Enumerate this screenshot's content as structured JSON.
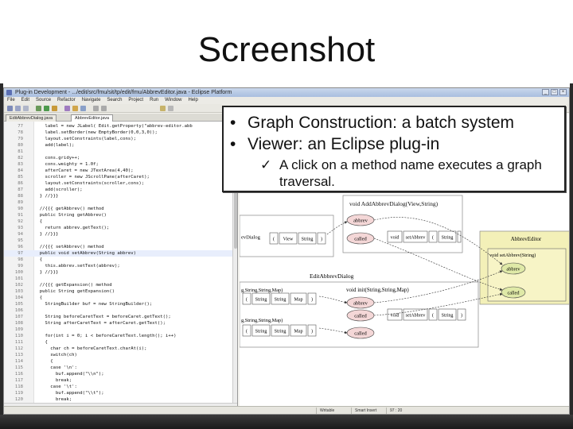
{
  "slide": {
    "title": "Screenshot",
    "callout": {
      "bullets": [
        "Graph Construction: a batch system",
        "Viewer: an Eclipse plug-in"
      ],
      "sub_bullet": "A click on a method name executes a graph traversal."
    }
  },
  "window": {
    "title": "Plug-in Development - .../edit/src/fmu/sit/tp/edit/fmu/AbbrevEditor.java - Eclipse Platform",
    "menu": [
      "File",
      "Edit",
      "Source",
      "Refactor",
      "Navigate",
      "Search",
      "Project",
      "Run",
      "Window",
      "Help"
    ]
  },
  "editor": {
    "tabs": [
      "EditAbbrevDialog.java",
      "AbbrevEditor.java"
    ],
    "lines": [
      {
        "n": "77",
        "code": "    label = new JLabel( Edit.getProperty(\"abbrev-editor.abb"
      },
      {
        "n": "78",
        "code": "    label.setBorder(new EmptyBorder(0,0,3,0));"
      },
      {
        "n": "79",
        "code": "    layout.setConstraints(label,cons);"
      },
      {
        "n": "80",
        "code": "    add(label);"
      },
      {
        "n": "81",
        "code": ""
      },
      {
        "n": "82",
        "code": "    cons.gridy++;"
      },
      {
        "n": "83",
        "code": "    cons.weighty = 1.0f;"
      },
      {
        "n": "84",
        "code": "    afterCaret = new JTextArea(4,40);"
      },
      {
        "n": "85",
        "code": "    scroller = new JScrollPane(afterCaret);"
      },
      {
        "n": "86",
        "code": "    layout.setConstraints(scroller,cons);"
      },
      {
        "n": "87",
        "code": "    add(scroller);"
      },
      {
        "n": "88",
        "code": "  } //}}}"
      },
      {
        "n": "89",
        "code": ""
      },
      {
        "n": "90",
        "code": "  //{{{ getAbbrev() method"
      },
      {
        "n": "91",
        "code": "  public String getAbbrev()"
      },
      {
        "n": "92",
        "code": "  {"
      },
      {
        "n": "93",
        "code": "    return abbrev.getText();"
      },
      {
        "n": "94",
        "code": "  } //}}}"
      },
      {
        "n": "95",
        "code": ""
      },
      {
        "n": "96",
        "code": "  //{{{ setAbbrev() method"
      },
      {
        "n": "97",
        "code": "  public void setAbbrev(String abbrev)"
      },
      {
        "n": "98",
        "code": "  {"
      },
      {
        "n": "99",
        "code": "    this.abbrev.setText(abbrev);"
      },
      {
        "n": "100",
        "code": "  } //}}}"
      },
      {
        "n": "101",
        "code": ""
      },
      {
        "n": "102",
        "code": "  //{{{ getExpansion() method"
      },
      {
        "n": "103",
        "code": "  public String getExpansion()"
      },
      {
        "n": "104",
        "code": "  {"
      },
      {
        "n": "105",
        "code": "    StringBuilder buf = new StringBuilder();"
      },
      {
        "n": "106",
        "code": ""
      },
      {
        "n": "107",
        "code": "    String beforeCaretText = beforeCaret.getText();"
      },
      {
        "n": "108",
        "code": "    String afterCaretText = afterCaret.getText();"
      },
      {
        "n": "109",
        "code": ""
      },
      {
        "n": "110",
        "code": "    for(int i = 0; i < beforeCaretText.length(); i++)"
      },
      {
        "n": "111",
        "code": "    {"
      },
      {
        "n": "112",
        "code": "      char ch = beforeCaretText.charAt(i);"
      },
      {
        "n": "113",
        "code": "      switch(ch)"
      },
      {
        "n": "114",
        "code": "      {"
      },
      {
        "n": "115",
        "code": "      case '\\n':"
      },
      {
        "n": "116",
        "code": "        buf.append(\"\\\\n\");"
      },
      {
        "n": "117",
        "code": "        break;"
      },
      {
        "n": "118",
        "code": "      case '\\t':"
      },
      {
        "n": "119",
        "code": "        buf.append(\"\\\\t\");"
      },
      {
        "n": "120",
        "code": "        break;"
      },
      {
        "n": "121",
        "code": "      case '\\\\':"
      }
    ]
  },
  "graph": {
    "nodes": {
      "add_abbrev_dialog": "void AddAbbrevDialog(View,String)",
      "abbrev_editor": "AbbrevEditor",
      "set_abbrev_string": "void setAbbrev(String)",
      "edit_abbrev_dialog": "EditAbbrevDialog",
      "init_method": "void init(String,String,Map)",
      "abbrev": "abbrev",
      "called": "called",
      "void": "void",
      "set_abbrev": "setAbbrev",
      "open_paren": "(",
      "close_paren": ")",
      "string": "String",
      "map": "Map",
      "view": "View",
      "ev_dialog_partial": "evDialog",
      "sig_partial_1": "g,String,String,Map)",
      "sig_partial_2": "g,String,String,Map)"
    }
  },
  "status": {
    "writable": "Writable",
    "insert": "Smart Insert",
    "position": "97 : 20"
  }
}
